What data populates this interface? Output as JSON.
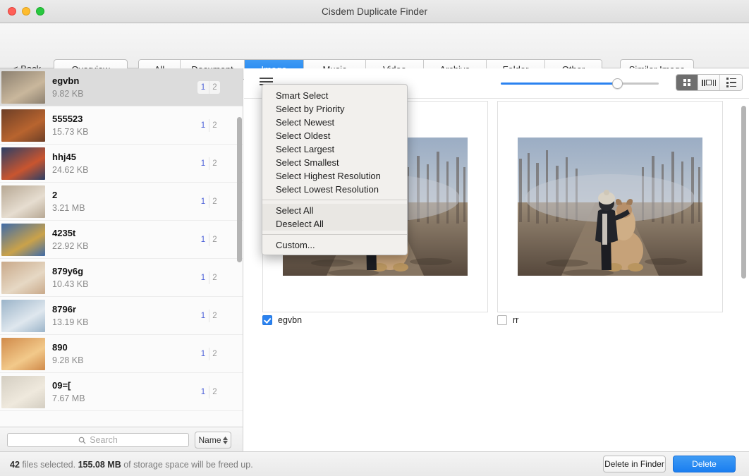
{
  "window": {
    "title": "Cisdem Duplicate Finder",
    "traffic_lights": [
      "close-button",
      "minimize-button",
      "zoom-button"
    ]
  },
  "toolbar": {
    "back_label": "< Back",
    "overview_label": "Overview",
    "tabs": [
      {
        "label": "All",
        "active": false
      },
      {
        "label": "Document",
        "active": false
      },
      {
        "label": "Image",
        "active": true
      },
      {
        "label": "Music",
        "active": false
      },
      {
        "label": "Video",
        "active": false
      },
      {
        "label": "Archive",
        "active": false
      },
      {
        "label": "Folder",
        "active": false
      },
      {
        "label": "Other",
        "active": false
      }
    ],
    "similar_image_label": "Similar Image",
    "accent_color": "#1a7ef0"
  },
  "sidebar": {
    "items": [
      {
        "name": "egvbn",
        "size": "9.82 KB",
        "count_a": "1",
        "count_b": "2",
        "selected": true
      },
      {
        "name": "555523",
        "size": "15.73 KB",
        "count_a": "1",
        "count_b": "2",
        "selected": false
      },
      {
        "name": "hhj45",
        "size": "24.62 KB",
        "count_a": "1",
        "count_b": "2",
        "selected": false
      },
      {
        "name": "2",
        "size": "3.21 MB",
        "count_a": "1",
        "count_b": "2",
        "selected": false
      },
      {
        "name": "4235t",
        "size": "22.92 KB",
        "count_a": "1",
        "count_b": "2",
        "selected": false
      },
      {
        "name": "879y6g",
        "size": "10.43 KB",
        "count_a": "1",
        "count_b": "2",
        "selected": false
      },
      {
        "name": "8796r",
        "size": "13.19 KB",
        "count_a": "1",
        "count_b": "2",
        "selected": false
      },
      {
        "name": "890",
        "size": "9.28 KB",
        "count_a": "1",
        "count_b": "2",
        "selected": false
      },
      {
        "name": "09=[",
        "size": "7.67 MB",
        "count_a": "1",
        "count_b": "2",
        "selected": false
      }
    ],
    "search": {
      "placeholder": "Search",
      "value": ""
    },
    "sort": {
      "label": "Name"
    }
  },
  "content": {
    "menu_icon": "hamburger-icon",
    "zoom_slider": {
      "value_percent": 71
    },
    "view_modes": [
      {
        "icon": "grid-view-icon",
        "active": true
      },
      {
        "icon": "filmstrip-view-icon",
        "active": false
      },
      {
        "icon": "list-view-icon",
        "active": false
      }
    ],
    "cards": [
      {
        "label": "egvbn",
        "checked": true
      },
      {
        "label": "rr",
        "checked": false
      }
    ]
  },
  "dropdown_menu": {
    "groups": [
      {
        "items": [
          "Smart Select",
          "Select by Priority",
          "Select Newest",
          "Select Oldest",
          "Select Largest",
          "Select Smallest",
          "Select Highest Resolution",
          "Select Lowest Resolution"
        ]
      },
      {
        "items": [
          "Select All",
          "Deselect All"
        ]
      },
      {
        "items": [
          "Custom..."
        ]
      }
    ]
  },
  "statusbar": {
    "count": "42",
    "mid_text": " files selected. ",
    "size": "155.08 MB",
    "tail_text": " of storage space will be freed up.",
    "delete_in_finder_label": "Delete in Finder",
    "delete_label": "Delete"
  }
}
